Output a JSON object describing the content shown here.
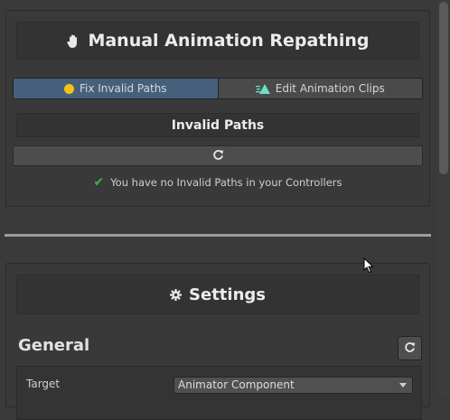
{
  "repathing": {
    "title": "Manual Animation Repathing",
    "title_icon": "hand-icon",
    "tabs": [
      {
        "label": "Fix Invalid Paths",
        "icon": "yellow-dot-icon",
        "active": true
      },
      {
        "label": "Edit Animation Clips",
        "icon": "animation-clip-icon",
        "active": false
      }
    ],
    "invalid_paths_header": "Invalid Paths",
    "refresh_icon": "refresh-icon",
    "status_message": "You have no Invalid Paths in your Controllers",
    "status_icon": "checkmark-icon"
  },
  "settings": {
    "title": "Settings",
    "title_icon": "gear-icon",
    "general_label": "General",
    "fields": [
      {
        "label": "Target",
        "value": "Animator Component"
      }
    ]
  },
  "colors": {
    "active_tab": "#46607c",
    "dot": "#f3c315",
    "check": "#36b84a",
    "clip_icon": "#6ee0c8"
  }
}
